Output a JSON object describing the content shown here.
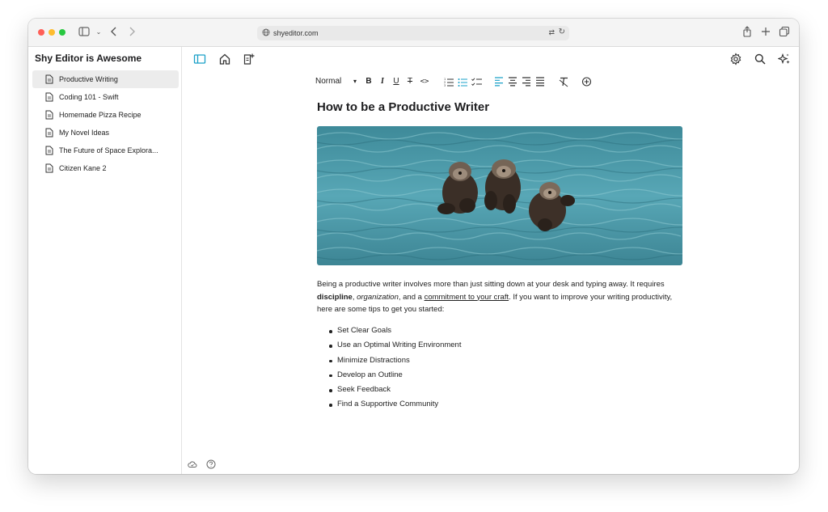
{
  "browser": {
    "url": "shyeditor.com"
  },
  "sidebar": {
    "title": "Shy Editor is Awesome",
    "items": [
      {
        "label": "Productive Writing",
        "active": true
      },
      {
        "label": "Coding 101 - Swift"
      },
      {
        "label": "Homemade Pizza Recipe"
      },
      {
        "label": "My Novel Ideas"
      },
      {
        "label": "The Future of Space Explora..."
      },
      {
        "label": "Citizen Kane 2"
      }
    ]
  },
  "toolbar": {
    "style_label": "Normal"
  },
  "document": {
    "title": "How to be a Productive Writer",
    "paragraph": {
      "part1": "Being a productive writer involves more than just sitting down at your desk and typing away. It requires ",
      "discipline": "discipline",
      "comma1": ", ",
      "organization": "organization",
      "part2": ", and a ",
      "commitment": "commitment to your craft",
      "part3": ". If you want to improve your writing productivity, here are some tips to get you started:"
    },
    "tips": [
      "Set Clear Goals",
      "Use an Optimal Writing Environment",
      "Minimize Distractions",
      "Develop an Outline",
      "Seek Feedback",
      "Find a Supportive Community"
    ]
  },
  "colors": {
    "accent": "#1aa0c8",
    "water": "#4b9bab"
  }
}
